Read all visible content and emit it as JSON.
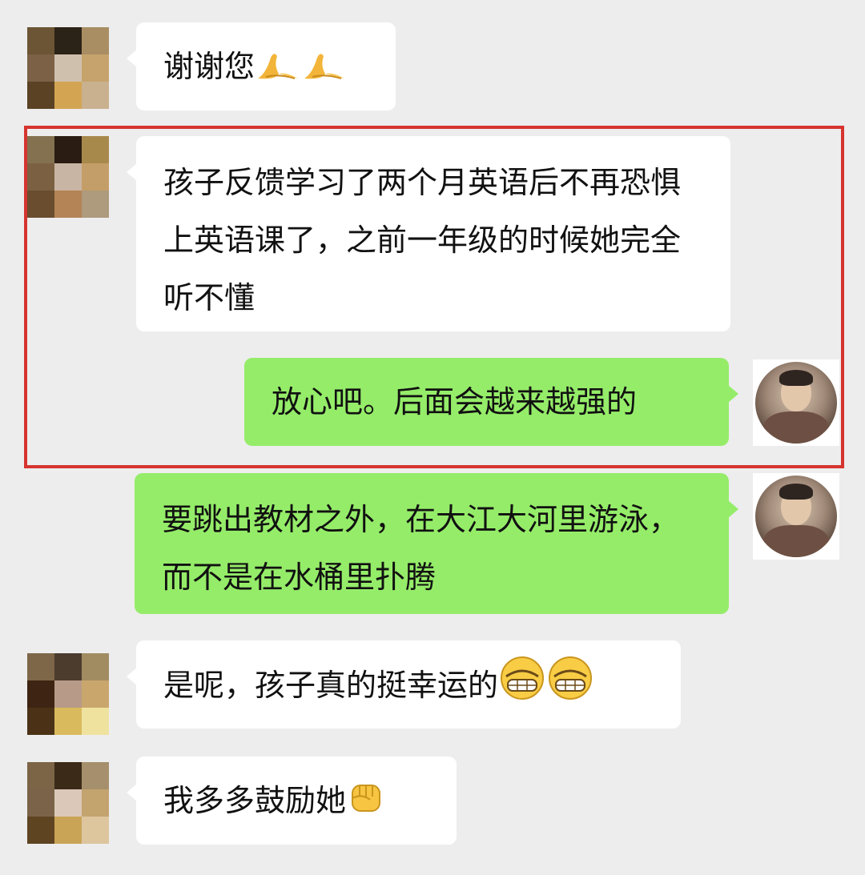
{
  "messages": [
    {
      "sender": "other",
      "text": "谢谢您",
      "emoji": [
        "pray-hands",
        "pray-hands"
      ]
    },
    {
      "sender": "other",
      "text": "孩子反馈学习了两个月英语后不再恐惧上英语课了，之前一年级的时候她完全听不懂"
    },
    {
      "sender": "self",
      "text": "放心吧。后面会越来越强的"
    },
    {
      "sender": "self",
      "text": "要跳出教材之外，在大江大河里游泳，而不是在水桶里扑腾"
    },
    {
      "sender": "other",
      "text": "是呢，孩子真的挺幸运的",
      "emoji": [
        "grinning-face",
        "grinning-face"
      ]
    },
    {
      "sender": "other",
      "text": "我多多鼓励她",
      "emoji": [
        "raised-fist"
      ]
    }
  ],
  "colors": {
    "background": "#ededed",
    "incoming_bubble": "#ffffff",
    "outgoing_bubble": "#95ec69",
    "highlight_border": "#d6342f"
  }
}
